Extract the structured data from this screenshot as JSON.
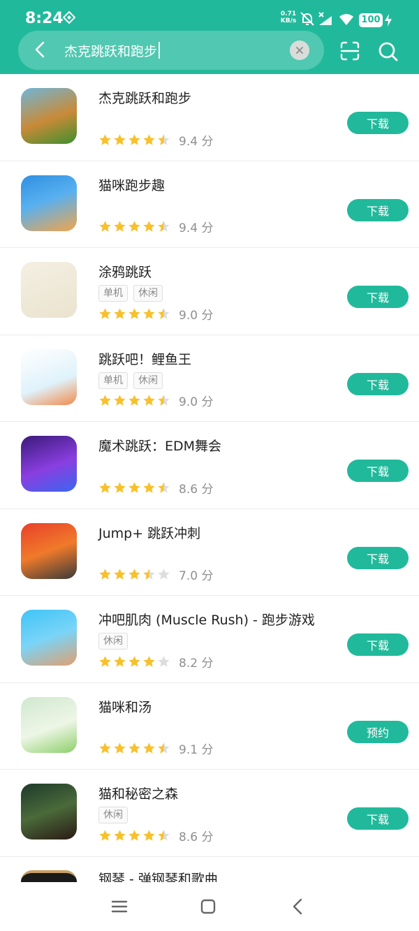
{
  "status_bar": {
    "time": "8:24",
    "net_speed_value": "0.71",
    "net_speed_unit": "KB/s",
    "battery": "100"
  },
  "search": {
    "query": "杰克跳跃和跑步",
    "icons": [
      "back-icon",
      "clear-icon",
      "scan-icon",
      "search-icon"
    ]
  },
  "colors": {
    "accent": "#21b99b",
    "star": "#f8c02b",
    "star_empty": "#dddddd"
  },
  "apps": [
    {
      "title": "杰克跳跃和跑步",
      "tags": [],
      "rating": 4.5,
      "score": "9.4 分",
      "action": "下载"
    },
    {
      "title": "猫咪跑步趣",
      "tags": [],
      "rating": 4.5,
      "score": "9.4 分",
      "action": "下载"
    },
    {
      "title": "涂鸦跳跃",
      "tags": [
        "单机",
        "休闲"
      ],
      "rating": 4.5,
      "score": "9.0 分",
      "action": "下载"
    },
    {
      "title": "跳跃吧！鲤鱼王",
      "tags": [
        "单机",
        "休闲"
      ],
      "rating": 4.5,
      "score": "9.0 分",
      "action": "下载"
    },
    {
      "title": "魔术跳跃：EDM舞会",
      "tags": [],
      "rating": 4.5,
      "score": "8.6 分",
      "action": "下载"
    },
    {
      "title": "Jump+ 跳跃冲刺",
      "tags": [],
      "rating": 3.5,
      "score": "7.0 分",
      "action": "下载"
    },
    {
      "title": "冲吧肌肉 (Muscle Rush) - 跑步游戏",
      "tags": [
        "休闲"
      ],
      "rating": 4,
      "score": "8.2 分",
      "action": "下载"
    },
    {
      "title": "猫咪和汤",
      "tags": [],
      "rating": 4.5,
      "score": "9.1 分",
      "action": "预约"
    },
    {
      "title": "猫和秘密之森",
      "tags": [
        "休闲"
      ],
      "rating": 4.5,
      "score": "8.6 分",
      "action": "下载"
    }
  ],
  "partial_app": {
    "title": "钢琴 - 弹钢琴和歌曲"
  },
  "nav": {
    "icons": [
      "menu-icon",
      "home-icon",
      "back-icon"
    ]
  }
}
